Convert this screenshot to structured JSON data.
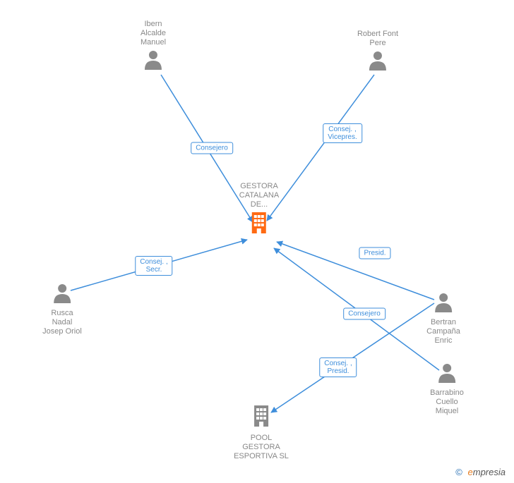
{
  "center": {
    "name": "GESTORA\nCATALANA\nDE..."
  },
  "persons": {
    "ibern": {
      "name": "Ibern\nAlcalde\nManuel"
    },
    "robert": {
      "name": "Robert Font\nPere"
    },
    "rusca": {
      "name": "Rusca\nNadal\nJosep Oriol"
    },
    "bertran": {
      "name": "Bertran\nCampaña\nEnric"
    },
    "barrabino": {
      "name": "Barrabino\nCuello\nMiquel"
    }
  },
  "company2": {
    "name": "POOL\nGESTORA\nESPORTIVA SL"
  },
  "edges": {
    "ibern_role": "Consejero",
    "robert_role": "Consej. ,\nVicepres.",
    "rusca_role": "Consej. ,\nSecr.",
    "bertran_role": "Presid.",
    "barrabino_role": "Consejero",
    "bertran_pool_role": "Consej. ,\nPresid."
  },
  "watermark": {
    "copyright": "©",
    "brand_e": "e",
    "brand_rest": "mpresia"
  },
  "colors": {
    "edge": "#3e8edb",
    "person": "#8a8a8a",
    "building_center": "#ff6a13",
    "building_other": "#8a8a8a"
  }
}
